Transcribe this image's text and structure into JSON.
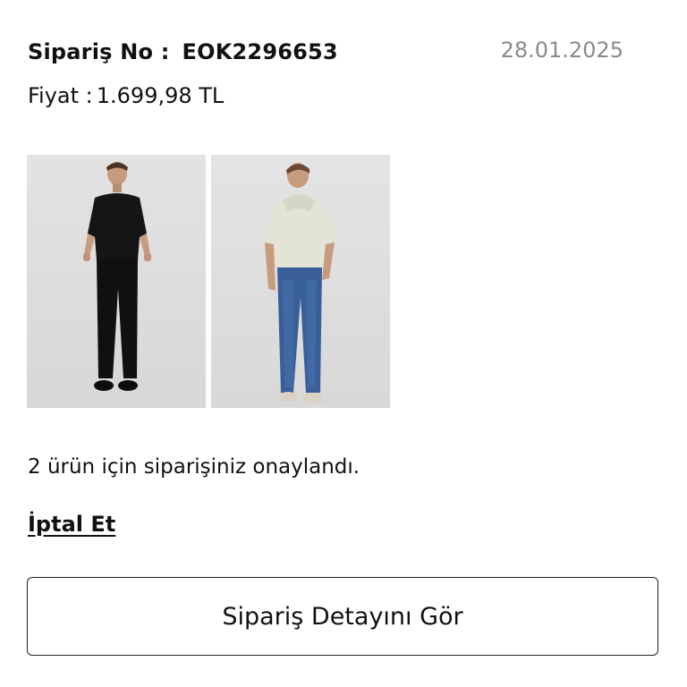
{
  "order": {
    "number_label": "Sipariş No :",
    "number_value": "EOK2296653",
    "date": "28.01.2025",
    "price_label": "Fiyat :",
    "price_value": "1.699,98 TL"
  },
  "products": [
    {
      "image": "man-black-polo-black-pants-photo"
    },
    {
      "image": "man-hoodie-blue-jeans-photo"
    }
  ],
  "status_text": "2 ürün için siparişiniz onaylandı.",
  "actions": {
    "cancel_label": "İptal Et",
    "details_label": "Sipariş Detayını Gör"
  }
}
